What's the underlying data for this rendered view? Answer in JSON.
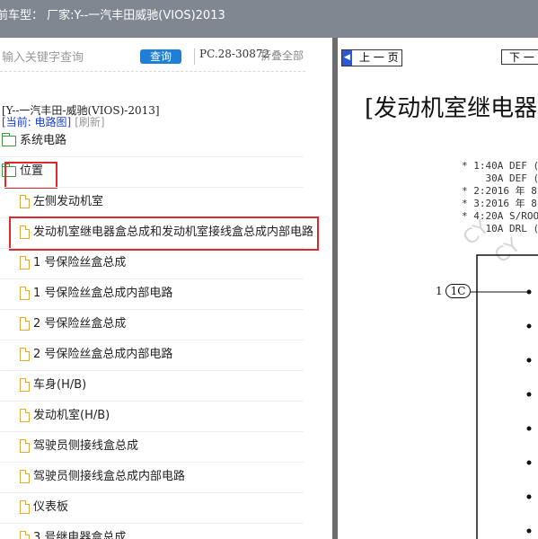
{
  "topbar": {
    "title": "前车型：  厂家:Y--一汽丰田威驰(VIOS)2013"
  },
  "search": {
    "placeholder": "输入关键字查询",
    "button_label": "查询",
    "code": "PC.28-30872",
    "collapse_all": "折叠全部"
  },
  "tree": {
    "title": "[Y--一汽丰田-威驰(VIOS)-2013]",
    "current_label": "[当前: 电路图]",
    "refresh_label": "[刷新]",
    "nodes": [
      {
        "label": "系统电路",
        "icon": "folder-icon"
      },
      {
        "label": "位置",
        "icon": "folder-open-icon",
        "highlighted": true
      },
      {
        "label": "左侧发动机室",
        "icon": "document-icon"
      },
      {
        "label": "发动机室继电器盒总成和发动机室接线盒总成内部电路",
        "icon": "document-icon",
        "highlighted": true
      },
      {
        "label": "1 号保险丝盒总成",
        "icon": "document-icon"
      },
      {
        "label": "1 号保险丝盒总成内部电路",
        "icon": "document-icon"
      },
      {
        "label": "2 号保险丝盒总成",
        "icon": "document-icon"
      },
      {
        "label": "2 号保险丝盒总成内部电路",
        "icon": "document-icon"
      },
      {
        "label": "车身(H/B)",
        "icon": "document-icon"
      },
      {
        "label": "发动机室(H/B)",
        "icon": "document-icon"
      },
      {
        "label": "驾驶员侧接线盒总成",
        "icon": "document-icon"
      },
      {
        "label": "驾驶员侧接线盒总成内部电路",
        "icon": "document-icon"
      },
      {
        "label": "仪表板",
        "icon": "document-icon"
      },
      {
        "label": "3 号继电器盒总成",
        "icon": "document-icon"
      }
    ]
  },
  "viewer": {
    "prev_label": "上 一 页",
    "next_label": "下 一",
    "doc_title": "[发动机室继电器",
    "notes": [
      "* 1:40A DEF (",
      "    30A DEF (",
      "* 2:2016 年 8",
      "* 3:2016 年 8",
      "* 4:20A S/ROO",
      "    10A DRL ("
    ],
    "connector_number": "1",
    "connector_label": "1C",
    "watermark": "CY"
  },
  "colors": {
    "topbar": "#7f8791",
    "accent": "#1f7fd6",
    "highlight": "#e0262e",
    "splitter": "#6c6c6c"
  }
}
